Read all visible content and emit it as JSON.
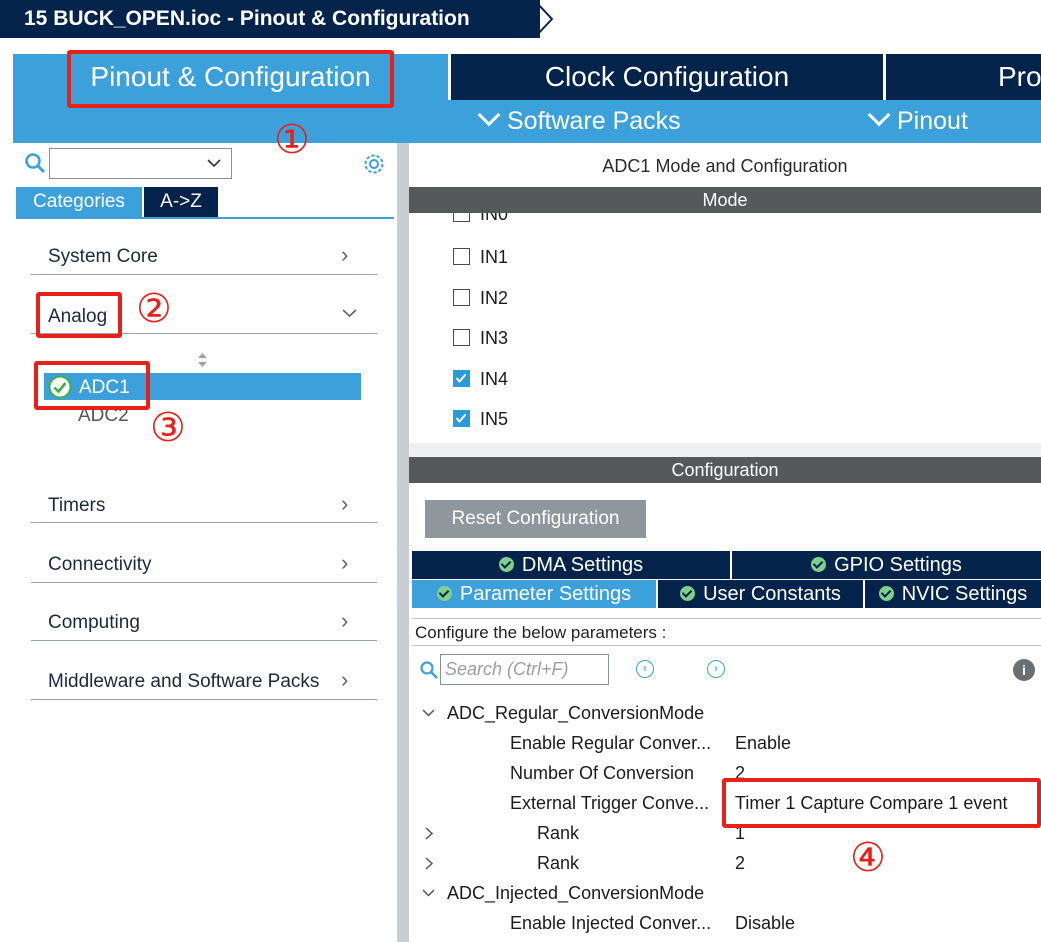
{
  "breadcrumb": {
    "title": "15 BUCK_OPEN.ioc - Pinout & Configuration"
  },
  "main_tabs": [
    {
      "label": "Pinout & Configuration"
    },
    {
      "label": "Clock Configuration"
    },
    {
      "label": "Pro"
    }
  ],
  "sub_menu": {
    "software_packs": "Software Packs",
    "pinout": "Pinout"
  },
  "left": {
    "search": {
      "value": ""
    },
    "tabs": {
      "categories": "Categories",
      "az": "A->Z"
    },
    "categories": {
      "system_core": "System Core",
      "analog": "Analog",
      "timers": "Timers",
      "connectivity": "Connectivity",
      "computing": "Computing",
      "middleware": "Middleware and Software Packs"
    },
    "analog_items": {
      "adc1": "ADC1",
      "adc2": "ADC2"
    }
  },
  "right": {
    "title": "ADC1 Mode and Configuration",
    "mode_header": "Mode",
    "mode_items": [
      {
        "label": "IN0",
        "checked": false
      },
      {
        "label": "IN1",
        "checked": false
      },
      {
        "label": "IN2",
        "checked": false
      },
      {
        "label": "IN3",
        "checked": false
      },
      {
        "label": "IN4",
        "checked": true
      },
      {
        "label": "IN5",
        "checked": true
      }
    ],
    "config_header": "Configuration",
    "reset_button": "Reset Configuration",
    "config_tabs": {
      "dma": "DMA Settings",
      "gpio": "GPIO Settings",
      "parameter": "Parameter Settings",
      "user_constants": "User Constants",
      "nvic": "NVIC Settings"
    },
    "params_label": "Configure the below parameters :",
    "search_placeholder": "Search (Ctrl+F)",
    "params": {
      "regular_group": "ADC_Regular_ConversionMode",
      "enable_regular_label": "Enable Regular Conver...",
      "enable_regular_value": "Enable",
      "num_conversion_label": "Number Of Conversion",
      "num_conversion_value": "2",
      "ext_trigger_label": "External Trigger Conve...",
      "ext_trigger_value": "Timer 1 Capture Compare 1 event",
      "rank_label": "Rank",
      "rank1_value": "1",
      "rank2_value": "2",
      "injected_group": "ADC_Injected_ConversionMode",
      "enable_injected_label": "Enable Injected Conver...",
      "enable_injected_value": "Disable"
    }
  },
  "annotations": {
    "a1": "①",
    "a2": "②",
    "a3": "③",
    "a4": "④"
  },
  "colors": {
    "accent": "#3ca1db",
    "navy": "#03234b",
    "annotation": "#e8201a",
    "header_gray": "#55595c"
  }
}
